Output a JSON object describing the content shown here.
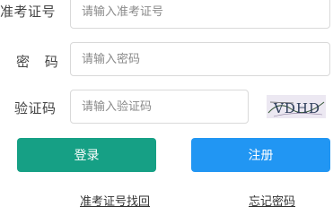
{
  "form": {
    "exam_id": {
      "label": "准考证号",
      "placeholder": "请输入准考证号",
      "value": ""
    },
    "password": {
      "label": "密 码",
      "placeholder": "请输入密码",
      "value": ""
    },
    "captcha": {
      "label": "验证码",
      "placeholder": "请输入验证码",
      "value": "",
      "image_text": "VDHD"
    }
  },
  "buttons": {
    "login": "登录",
    "register": "注册"
  },
  "links": {
    "recover_exam_id": "准考证号找回",
    "forgot_password": "忘记密码"
  },
  "colors": {
    "login_button": "#16a085",
    "register_button": "#2196f3"
  }
}
